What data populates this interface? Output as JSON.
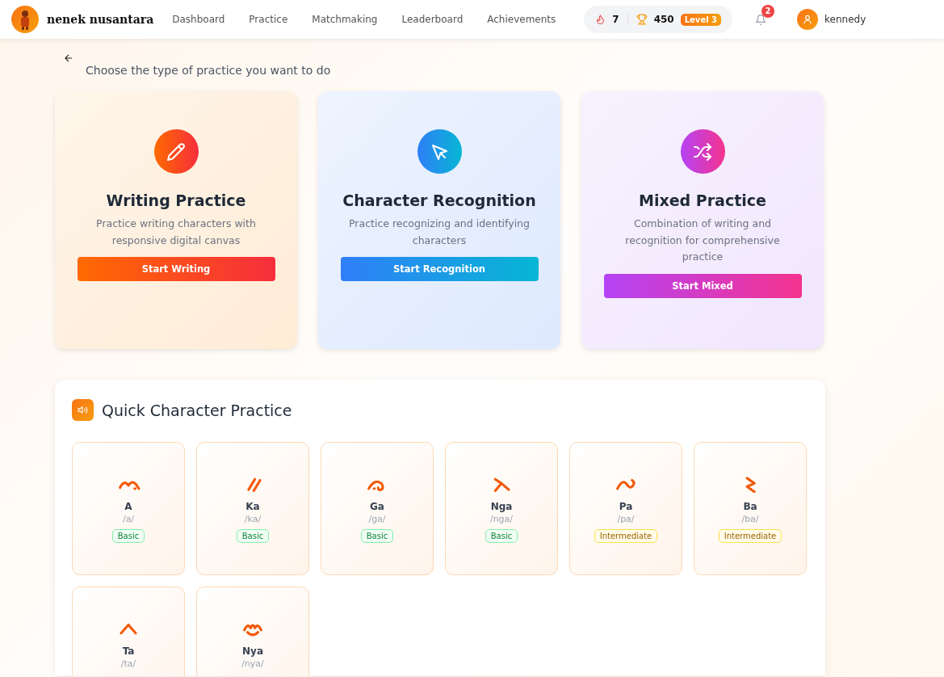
{
  "header": {
    "brand": "nenek nusantara",
    "nav": [
      {
        "label": "Dashboard",
        "selected": false
      },
      {
        "label": "Practice",
        "selected": false
      },
      {
        "label": "Matchmaking",
        "selected": false
      },
      {
        "label": "Leaderboard",
        "selected": false
      },
      {
        "label": "Achievements",
        "selected": false
      }
    ],
    "streak": "7",
    "points": "450",
    "level_badge": "Level 3",
    "notifications": "2",
    "user": "kennedy"
  },
  "subtitle": "Choose the type of practice you want to do",
  "modes": [
    {
      "kind": "writing",
      "title": "Writing Practice",
      "description": "Practice writing characters with responsive digital canvas",
      "button": "Start Writing"
    },
    {
      "kind": "recognition",
      "title": "Character Recognition",
      "description": "Practice recognizing and identifying characters",
      "button": "Start Recognition"
    },
    {
      "kind": "mixed",
      "title": "Mixed Practice",
      "description": "Combination of writing and recognition for comprehensive practice",
      "button": "Start Mixed"
    }
  ],
  "quick": {
    "title": "Quick Character Practice",
    "characters": [
      {
        "name": "A",
        "sound": "/a/",
        "difficulty": {
          "kind": "basic",
          "label": "Basic"
        }
      },
      {
        "name": "Ka",
        "sound": "/ka/",
        "difficulty": {
          "kind": "basic",
          "label": "Basic"
        }
      },
      {
        "name": "Ga",
        "sound": "/ga/",
        "difficulty": {
          "kind": "basic",
          "label": "Basic"
        }
      },
      {
        "name": "Nga",
        "sound": "/nga/",
        "difficulty": {
          "kind": "basic",
          "label": "Basic"
        }
      },
      {
        "name": "Pa",
        "sound": "/pa/",
        "difficulty": {
          "kind": "intermediate",
          "label": "Intermediate"
        }
      },
      {
        "name": "Ba",
        "sound": "/ba/",
        "difficulty": {
          "kind": "intermediate",
          "label": "Intermediate"
        }
      },
      {
        "name": "Ta",
        "sound": "/ta/"
      },
      {
        "name": "Nya",
        "sound": "/nya/"
      }
    ]
  }
}
